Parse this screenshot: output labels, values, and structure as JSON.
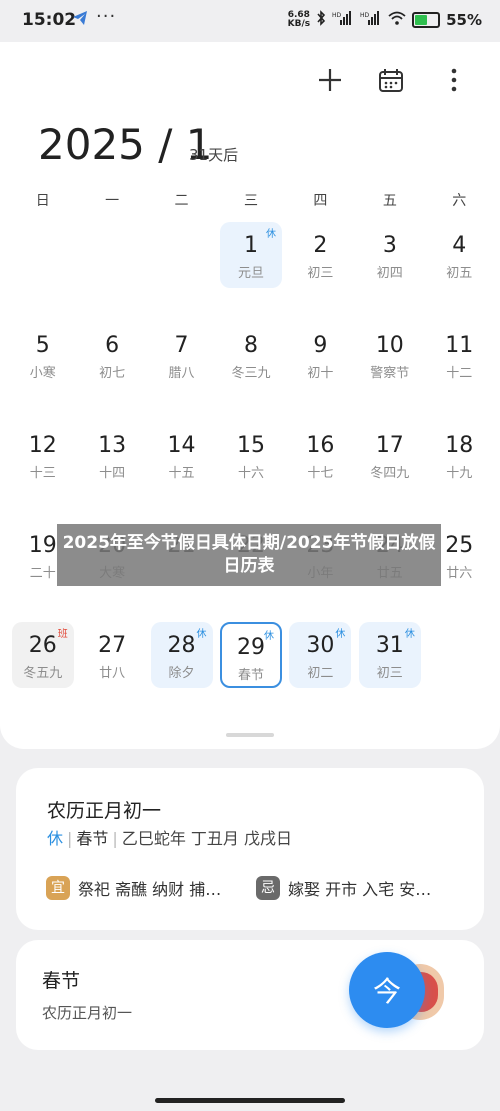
{
  "status_bar": {
    "time": "15:02",
    "speed_value": "6.68",
    "speed_unit": "KB/s",
    "battery_pct": "55%",
    "battery_level": 0.55,
    "icons": [
      "telegram-icon",
      "bluetooth-icon",
      "signal-hd-icon",
      "signal-hd-2-icon",
      "wifi-icon",
      "battery-icon"
    ]
  },
  "header": {
    "year_month": "2025 / 1",
    "days_after": "31天后",
    "add_icon": "plus-icon",
    "calendar_icon": "calendar-icon",
    "more_icon": "more-vertical-icon"
  },
  "weekdays": [
    "日",
    "一",
    "二",
    "三",
    "四",
    "五",
    "六"
  ],
  "weeks": [
    [
      {
        "num": "",
        "lunar": "",
        "tag": "",
        "style": "empty"
      },
      {
        "num": "",
        "lunar": "",
        "tag": "",
        "style": "empty"
      },
      {
        "num": "",
        "lunar": "",
        "tag": "",
        "style": "empty"
      },
      {
        "num": "1",
        "lunar": "元旦",
        "tag": "休",
        "style": "holiday"
      },
      {
        "num": "2",
        "lunar": "初三",
        "tag": "",
        "style": ""
      },
      {
        "num": "3",
        "lunar": "初四",
        "tag": "",
        "style": ""
      },
      {
        "num": "4",
        "lunar": "初五",
        "tag": "",
        "style": ""
      }
    ],
    [
      {
        "num": "5",
        "lunar": "小寒",
        "tag": "",
        "style": ""
      },
      {
        "num": "6",
        "lunar": "初七",
        "tag": "",
        "style": ""
      },
      {
        "num": "7",
        "lunar": "腊八",
        "tag": "",
        "style": ""
      },
      {
        "num": "8",
        "lunar": "冬三九",
        "tag": "",
        "style": ""
      },
      {
        "num": "9",
        "lunar": "初十",
        "tag": "",
        "style": ""
      },
      {
        "num": "10",
        "lunar": "警察节",
        "tag": "",
        "style": ""
      },
      {
        "num": "11",
        "lunar": "十二",
        "tag": "",
        "style": ""
      }
    ],
    [
      {
        "num": "12",
        "lunar": "十三",
        "tag": "",
        "style": ""
      },
      {
        "num": "13",
        "lunar": "十四",
        "tag": "",
        "style": ""
      },
      {
        "num": "14",
        "lunar": "十五",
        "tag": "",
        "style": ""
      },
      {
        "num": "15",
        "lunar": "十六",
        "tag": "",
        "style": ""
      },
      {
        "num": "16",
        "lunar": "十七",
        "tag": "",
        "style": ""
      },
      {
        "num": "17",
        "lunar": "冬四九",
        "tag": "",
        "style": ""
      },
      {
        "num": "18",
        "lunar": "十九",
        "tag": "",
        "style": ""
      }
    ],
    [
      {
        "num": "19",
        "lunar": "二十",
        "tag": "",
        "style": ""
      },
      {
        "num": "20",
        "lunar": "大寒",
        "tag": "",
        "style": ""
      },
      {
        "num": "21",
        "lunar": "",
        "tag": "",
        "style": ""
      },
      {
        "num": "22",
        "lunar": "",
        "tag": "",
        "style": ""
      },
      {
        "num": "23",
        "lunar": "小年",
        "tag": "",
        "style": ""
      },
      {
        "num": "24",
        "lunar": "廿五",
        "tag": "",
        "style": ""
      },
      {
        "num": "25",
        "lunar": "廿六",
        "tag": "",
        "style": ""
      }
    ],
    [
      {
        "num": "26",
        "lunar": "冬五九",
        "tag": "班",
        "style": "workday"
      },
      {
        "num": "27",
        "lunar": "廿八",
        "tag": "",
        "style": ""
      },
      {
        "num": "28",
        "lunar": "除夕",
        "tag": "休",
        "style": "holiday"
      },
      {
        "num": "29",
        "lunar": "春节",
        "tag": "休",
        "style": "selected"
      },
      {
        "num": "30",
        "lunar": "初二",
        "tag": "休",
        "style": "holiday"
      },
      {
        "num": "31",
        "lunar": "初三",
        "tag": "休",
        "style": "holiday"
      },
      {
        "num": "",
        "lunar": "",
        "tag": "",
        "style": "empty"
      }
    ]
  ],
  "overlay_caption": "2025年至今节假日具体日期/2025年节假日放假日历表",
  "detail_card": {
    "lunar_date": "农历正月初一",
    "rest_tag": "休",
    "festival": "春节",
    "ganzhi": "乙巳蛇年 丁丑月 戊戌日",
    "yi_label": "宜",
    "yi_items": "祭祀 斋醮 纳财 捕…",
    "ji_label": "忌",
    "ji_items": "嫁娶 开市 入宅 安…"
  },
  "festival_card": {
    "title": "春节",
    "subtitle": "农历正月初一"
  },
  "fab": {
    "label": "今"
  }
}
